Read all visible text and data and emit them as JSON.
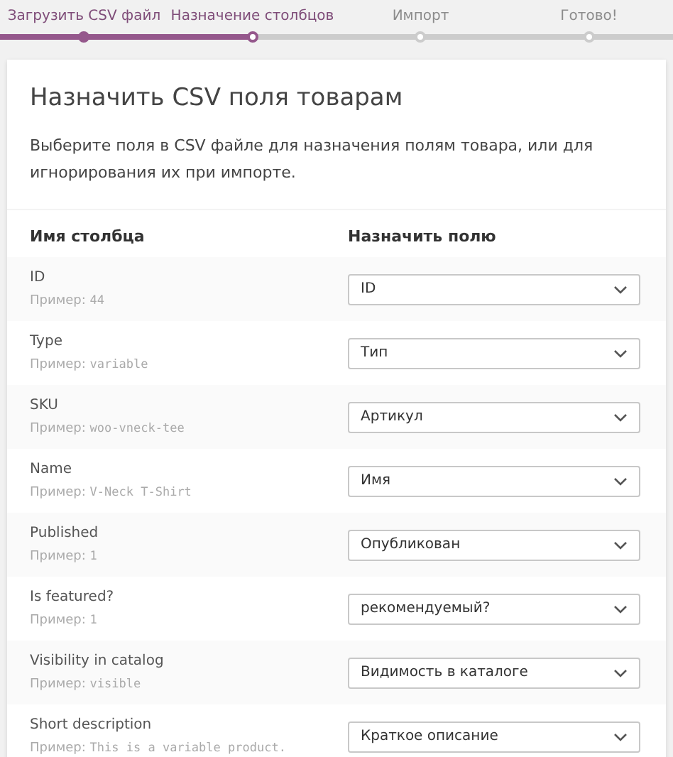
{
  "steps": [
    {
      "label": "Загрузить CSV файл",
      "completed": true,
      "current": false
    },
    {
      "label": "Назначение столбцов",
      "completed": false,
      "current": true
    },
    {
      "label": "Импорт",
      "completed": false,
      "current": false
    },
    {
      "label": "Готово!",
      "completed": false,
      "current": false
    }
  ],
  "card": {
    "title": "Назначить CSV поля товарам",
    "description": "Выберите поля в CSV файле для назначения полям товара, или для игнорирования их при импорте."
  },
  "table": {
    "columns": [
      "Имя столбца",
      "Назначить полю"
    ],
    "rows": [
      {
        "name": "ID",
        "example_label": "Пример:",
        "example": "44",
        "field": "ID"
      },
      {
        "name": "Type",
        "example_label": "Пример:",
        "example": "variable",
        "field": "Тип"
      },
      {
        "name": "SKU",
        "example_label": "Пример:",
        "example": "woo-vneck-tee",
        "field": "Артикул"
      },
      {
        "name": "Name",
        "example_label": "Пример:",
        "example": "V-Neck T-Shirt",
        "field": "Имя"
      },
      {
        "name": "Published",
        "example_label": "Пример:",
        "example": "1",
        "field": "Опубликован"
      },
      {
        "name": "Is featured?",
        "example_label": "Пример:",
        "example": "1",
        "field": "рекомендуемый?"
      },
      {
        "name": "Visibility in catalog",
        "example_label": "Пример:",
        "example": "visible",
        "field": "Видимость в каталоге"
      },
      {
        "name": "Short description",
        "example_label": "Пример:",
        "example": "This is a variable product.",
        "field": "Краткое описание"
      }
    ]
  }
}
